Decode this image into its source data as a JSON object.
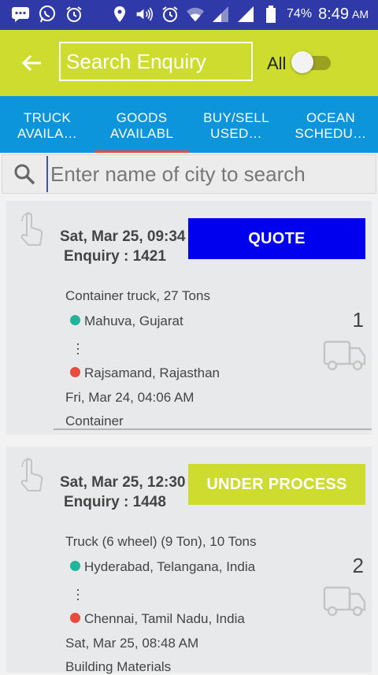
{
  "status_bar": {
    "icons": [
      "message-icon",
      "whatsapp-icon",
      "alarm-icon",
      "location-icon",
      "volume-icon",
      "alarm-icon",
      "wifi-icon",
      "signal-icon",
      "signal-icon",
      "battery-icon"
    ],
    "battery": "74%",
    "time": "8:49",
    "ampm": "AM"
  },
  "appbar": {
    "search_placeholder": "Search Enquiry",
    "toggle_label": "All",
    "toggle_on": false
  },
  "tabs": [
    {
      "line1": "TRUCK",
      "line2": "AVAILA…",
      "active": false
    },
    {
      "line1": "GOODS",
      "line2": "AVAILABL",
      "active": true
    },
    {
      "line1": "BUY/SELL",
      "line2": "USED…",
      "active": false
    },
    {
      "line1": "OCEAN",
      "line2": "SCHEDU…",
      "active": false
    }
  ],
  "city_search": {
    "placeholder": "Enter name of city to search"
  },
  "cards": [
    {
      "date": "Sat, Mar 25, 09:34",
      "enquiry": "Enquiry : 1421",
      "action": "QUOTE",
      "vehicle": "Container truck,  27 Tons",
      "from": "Mahuva, Gujarat",
      "to": "Rajsamand, Rajasthan",
      "load_date": "Fri, Mar 24, 04:06 AM",
      "material": "Container",
      "count": "1"
    },
    {
      "date": "Sat, Mar 25, 12:30",
      "enquiry": "Enquiry : 1448",
      "action": "UNDER PROCESS",
      "vehicle": "Truck (6 wheel) (9 Ton),  10 Tons",
      "from": "Hyderabad, Telangana, India",
      "to": "Chennai, Tamil Nadu, India",
      "load_date": "Sat, Mar 25, 08:48 AM",
      "material": "Building Materials",
      "count": "2"
    }
  ],
  "colors": {
    "status_bar": "#2f3aa8",
    "appbar": "#cddc2f",
    "tabs": "#0d95db",
    "tab_indicator": "#e74c3c",
    "quote_button": "#0000ee",
    "process_button": "#cddc2f",
    "origin_dot": "#1fb59a",
    "destination_dot": "#e74c3c"
  }
}
